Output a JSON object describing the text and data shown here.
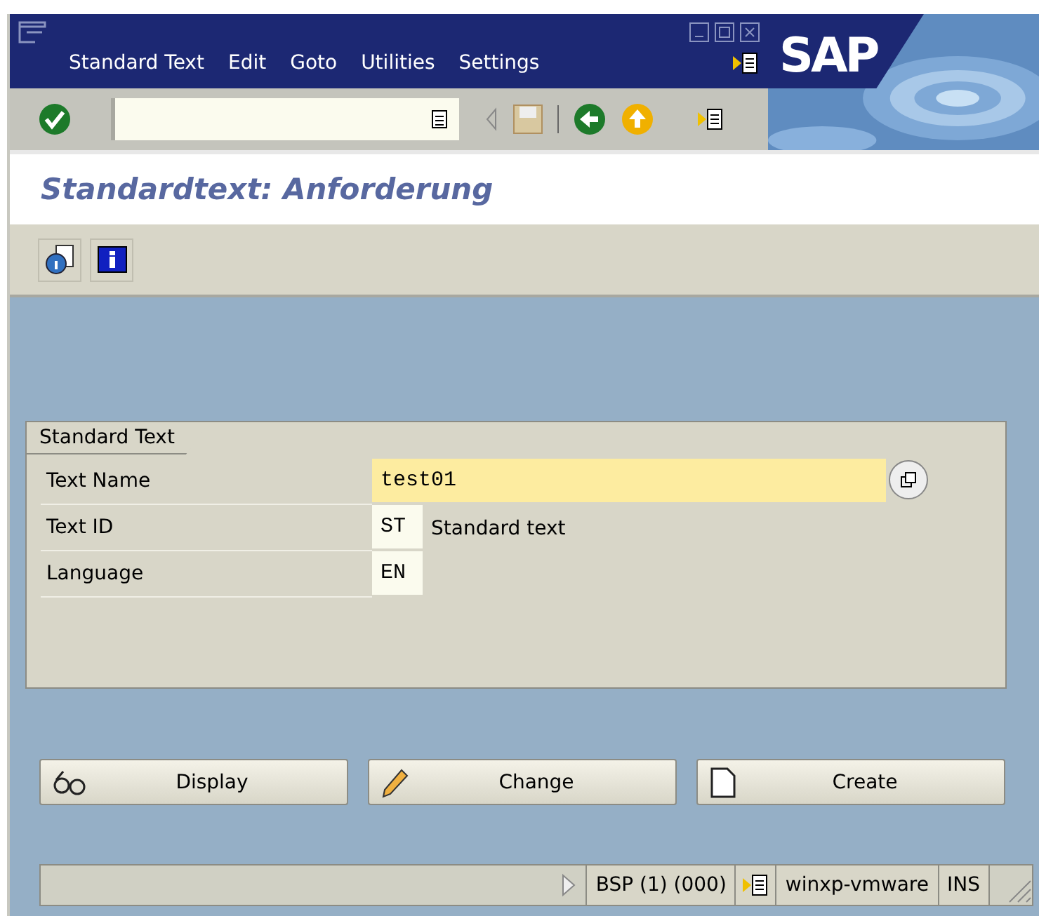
{
  "menu_bar": {
    "items": [
      "Standard Text",
      "Edit",
      "Goto",
      "Utilities",
      "Settings"
    ],
    "logo": "SAP"
  },
  "screen_title": "Standardtext: Anforderung",
  "group": {
    "title": "Standard Text",
    "fields": [
      {
        "label": "Text Name",
        "value": "test01",
        "focused": true
      },
      {
        "label": "Text ID",
        "value": "ST",
        "focused": false,
        "description": "Standard text"
      },
      {
        "label": "Language",
        "value": "EN",
        "focused": false
      }
    ]
  },
  "buttons": [
    {
      "kind": "display",
      "label": "Display"
    },
    {
      "kind": "change",
      "label": "Change"
    },
    {
      "kind": "create",
      "label": "Create"
    }
  ],
  "status_bar": {
    "session": "BSP (1) (000)",
    "server": "winxp-vmware",
    "mode": "INS"
  }
}
